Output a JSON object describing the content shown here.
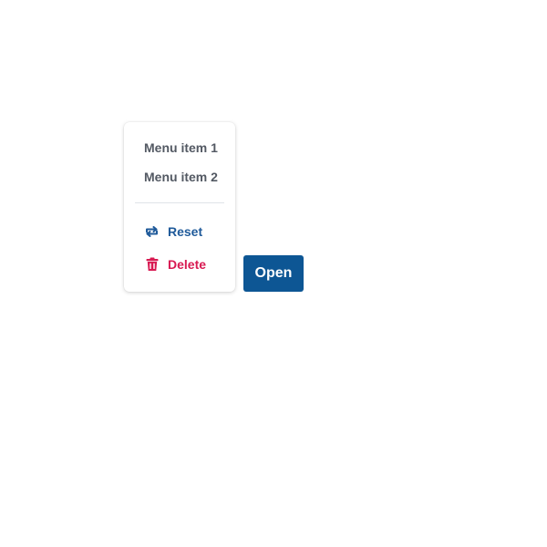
{
  "menu": {
    "items": [
      {
        "label": "Menu item 1"
      },
      {
        "label": "Menu item 2"
      }
    ],
    "actions": {
      "reset": {
        "label": "Reset",
        "icon": "reset-icon",
        "color": "#1f5a9a"
      },
      "delete": {
        "label": "Delete",
        "icon": "trash-icon",
        "color": "#d81a52"
      }
    }
  },
  "open_button": {
    "label": "Open",
    "color": "#0d5694"
  }
}
